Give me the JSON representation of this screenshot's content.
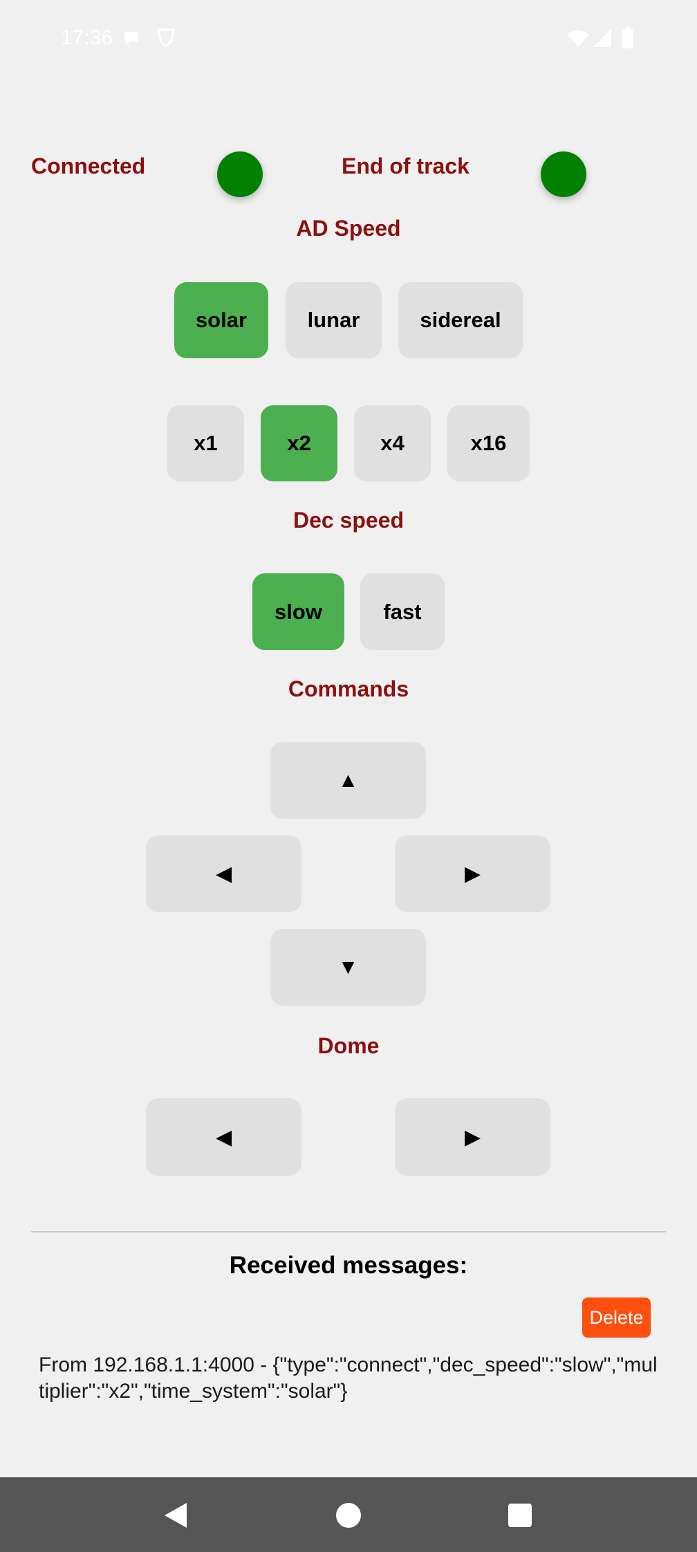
{
  "status_bar": {
    "time": "17:36"
  },
  "indicators": {
    "connected_label": "Connected",
    "end_of_track_label": "End of track",
    "connected_color": "#018001",
    "end_of_track_color": "#018001"
  },
  "ad_speed": {
    "title": "AD Speed",
    "time_systems": [
      "solar",
      "lunar",
      "sidereal"
    ],
    "selected_time_system": "solar",
    "multipliers": [
      "x1",
      "x2",
      "x4",
      "x16"
    ],
    "selected_multiplier": "x2"
  },
  "dec_speed": {
    "title": "Dec speed",
    "options": [
      "slow",
      "fast"
    ],
    "selected": "slow"
  },
  "commands": {
    "title": "Commands",
    "up": "▲",
    "left": "◀",
    "right": "▶",
    "down": "▼"
  },
  "dome": {
    "title": "Dome",
    "left": "◀",
    "right": "▶"
  },
  "messages": {
    "title": "Received messages:",
    "delete_label": "Delete",
    "items": [
      "From 192.168.1.1:4000 - {\"type\":\"connect\",\"dec_speed\":\"slow\",\"multiplier\":\"x2\",\"time_system\":\"solar\"}"
    ]
  },
  "colors": {
    "accent_text": "#8b1010",
    "selected_button": "#4caf50",
    "delete_button": "#ff4f0f"
  }
}
